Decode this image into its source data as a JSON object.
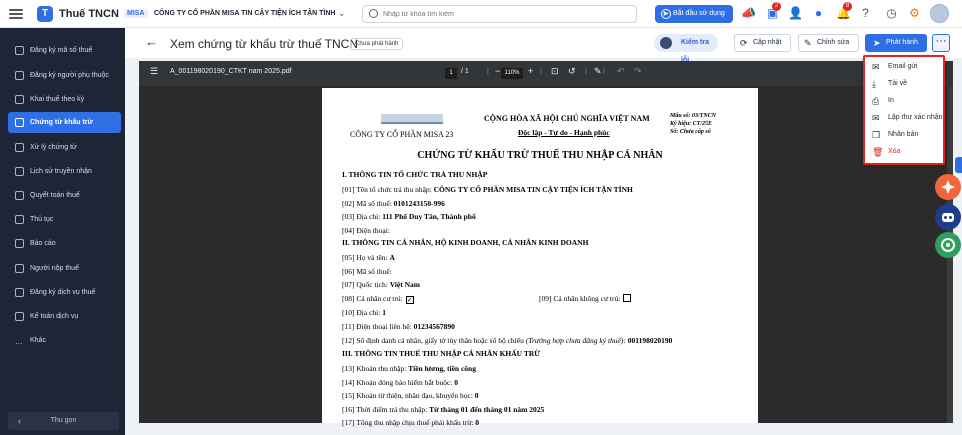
{
  "app": {
    "name": "Thuế TNCN",
    "logo_letter": "T"
  },
  "org": {
    "tag": "MISA",
    "name": "CÔNG TY CỔ PHẦN MISA TIN CẬY TIỆN ÍCH TẬN TÌNH"
  },
  "search": {
    "placeholder": "Nhập từ khóa tìm kiếm",
    "value": ""
  },
  "topbar": {
    "start_label": "Bắt đầu sử dụng",
    "badge_bell": "2",
    "badge_notify": "8"
  },
  "sidebar": {
    "items": [
      {
        "label": "Đăng ký mã số thuế",
        "active": false
      },
      {
        "label": "Đăng ký người phụ thuộc",
        "active": false
      },
      {
        "label": "Khai thuế theo kỳ",
        "active": false
      },
      {
        "label": "Chứng từ khấu trừ",
        "active": true
      },
      {
        "label": "Xử lý chứng từ",
        "active": false
      },
      {
        "label": "Lịch sử truyền nhận",
        "active": false
      },
      {
        "label": "Quyết toán thuế",
        "active": false
      },
      {
        "label": "Thủ tục",
        "active": false
      },
      {
        "label": "Báo cáo",
        "active": false
      },
      {
        "label": "Người nộp thuế",
        "active": false
      },
      {
        "label": "Đăng ký dịch vụ thuế",
        "active": false
      },
      {
        "label": "Kế toán dịch vụ",
        "active": false
      },
      {
        "label": "Khác",
        "active": false
      }
    ],
    "collapse_label": "Thu gọn"
  },
  "header": {
    "title": "Xem chứng từ khấu trừ thuế TNCN",
    "status": "Chưa phát hành",
    "ai_label": "Kiểm tra lỗi",
    "update_label": "Cập nhật",
    "edit_label": "Chỉnh sửa",
    "publish_label": "Phát hành",
    "more_label": "···"
  },
  "viewer": {
    "filename": "A_001198020190_CTKT nam 2025.pdf",
    "page_current": "1",
    "page_total": "/ 1",
    "zoom": "110%"
  },
  "document": {
    "company": "CÔNG TY CỔ PHẦN MISA 23",
    "nation": "CỘNG HÒA XÃ HỘI CHỦ NGHĨA VIỆT NAM",
    "motto": "Độc lập - Tự do - Hạnh phúc",
    "form_no": "Mẫu số: 03/TNCN",
    "symbol": "Ký hiệu: CT/25E",
    "number": "Số: Chưa cấp số",
    "title": "CHỨNG TỪ KHẤU TRỪ THUẾ THU NHẬP CÁ NHÂN",
    "s1": "I.   THÔNG TIN TỔ CHỨC TRẢ THU NHẬP",
    "f01_label": "[01]  Tên tổ chức trả thu nhập:",
    "f01_value": "CÔNG TY CỔ PHẦN MISA TIN CẬY TIỆN ÍCH TẬN TÌNH",
    "f02_label": "[02]  Mã số thuế:",
    "f02_value": "0101243150-996",
    "f03_label": "[03]  Địa chỉ:",
    "f03_value": "111 Phố Duy Tân, Thành phố",
    "f04_label": "[04]  Điện thoại:",
    "s2": "II.   THÔNG TIN CÁ NHÂN, HỘ KINH DOANH, CÁ NHÂN KINH DOANH",
    "f05_label": "[05]  Họ và tên:",
    "f05_value": "A",
    "f06_label": "[06]  Mã số thuế:",
    "f07_label": "[07]  Quốc tịch:",
    "f07_value": "Việt Nam",
    "f08_label": "[08]  Cá nhân cư trú:",
    "f08_check": "✓",
    "f09_label": "[09]  Cá nhân không cư trú:",
    "f10_label": "[10]  Địa chỉ:",
    "f10_value": "1",
    "f11_label": "[11]  Điện thoại liên hệ:",
    "f11_value": "01234567890",
    "f12_label": "[12]   Số định danh cá nhân, giấy tờ tùy thân hoặc số hộ chiếu",
    "f12_note": "(Trường hợp chưa đăng ký thuế):",
    "f12_value": "001198020190",
    "s3": "III.   THÔNG TIN THUẾ THU NHẬP CÁ NHÂN KHẤU TRỪ",
    "f13_label": "[13]  Khoản thu nhập:",
    "f13_value": "Tiền lương, tiền công",
    "f14_label": "[14]  Khoản đóng bảo hiểm bắt buộc:",
    "f14_value": "0",
    "f15_label": "[15]  Khoản từ thiện, nhân đạo, khuyến học:",
    "f15_value": "0",
    "f16_label": "[16]  Thời điểm trả thu nhập:",
    "f16_value": "Từ tháng 01  đến tháng 01  năm 2025",
    "f17_label": "[17]  Tổng thu nhập chịu thuế phải khấu trừ:",
    "f17_value": "0"
  },
  "menu": {
    "items": [
      {
        "label": "Email gửi",
        "icon": "mail-icon"
      },
      {
        "label": "Tải về",
        "icon": "download-icon"
      },
      {
        "label": "In",
        "icon": "print-icon"
      },
      {
        "label": "Lập thư xác nhận",
        "icon": "mail-check-icon"
      },
      {
        "label": "Nhân bản",
        "icon": "copy-icon"
      },
      {
        "label": "Xóa",
        "icon": "trash-icon"
      }
    ]
  },
  "colors": {
    "primary": "#2f6fe4",
    "sidebar": "#1d2536",
    "danger": "#e02424",
    "viewer_bg": "#2b2b2b"
  }
}
